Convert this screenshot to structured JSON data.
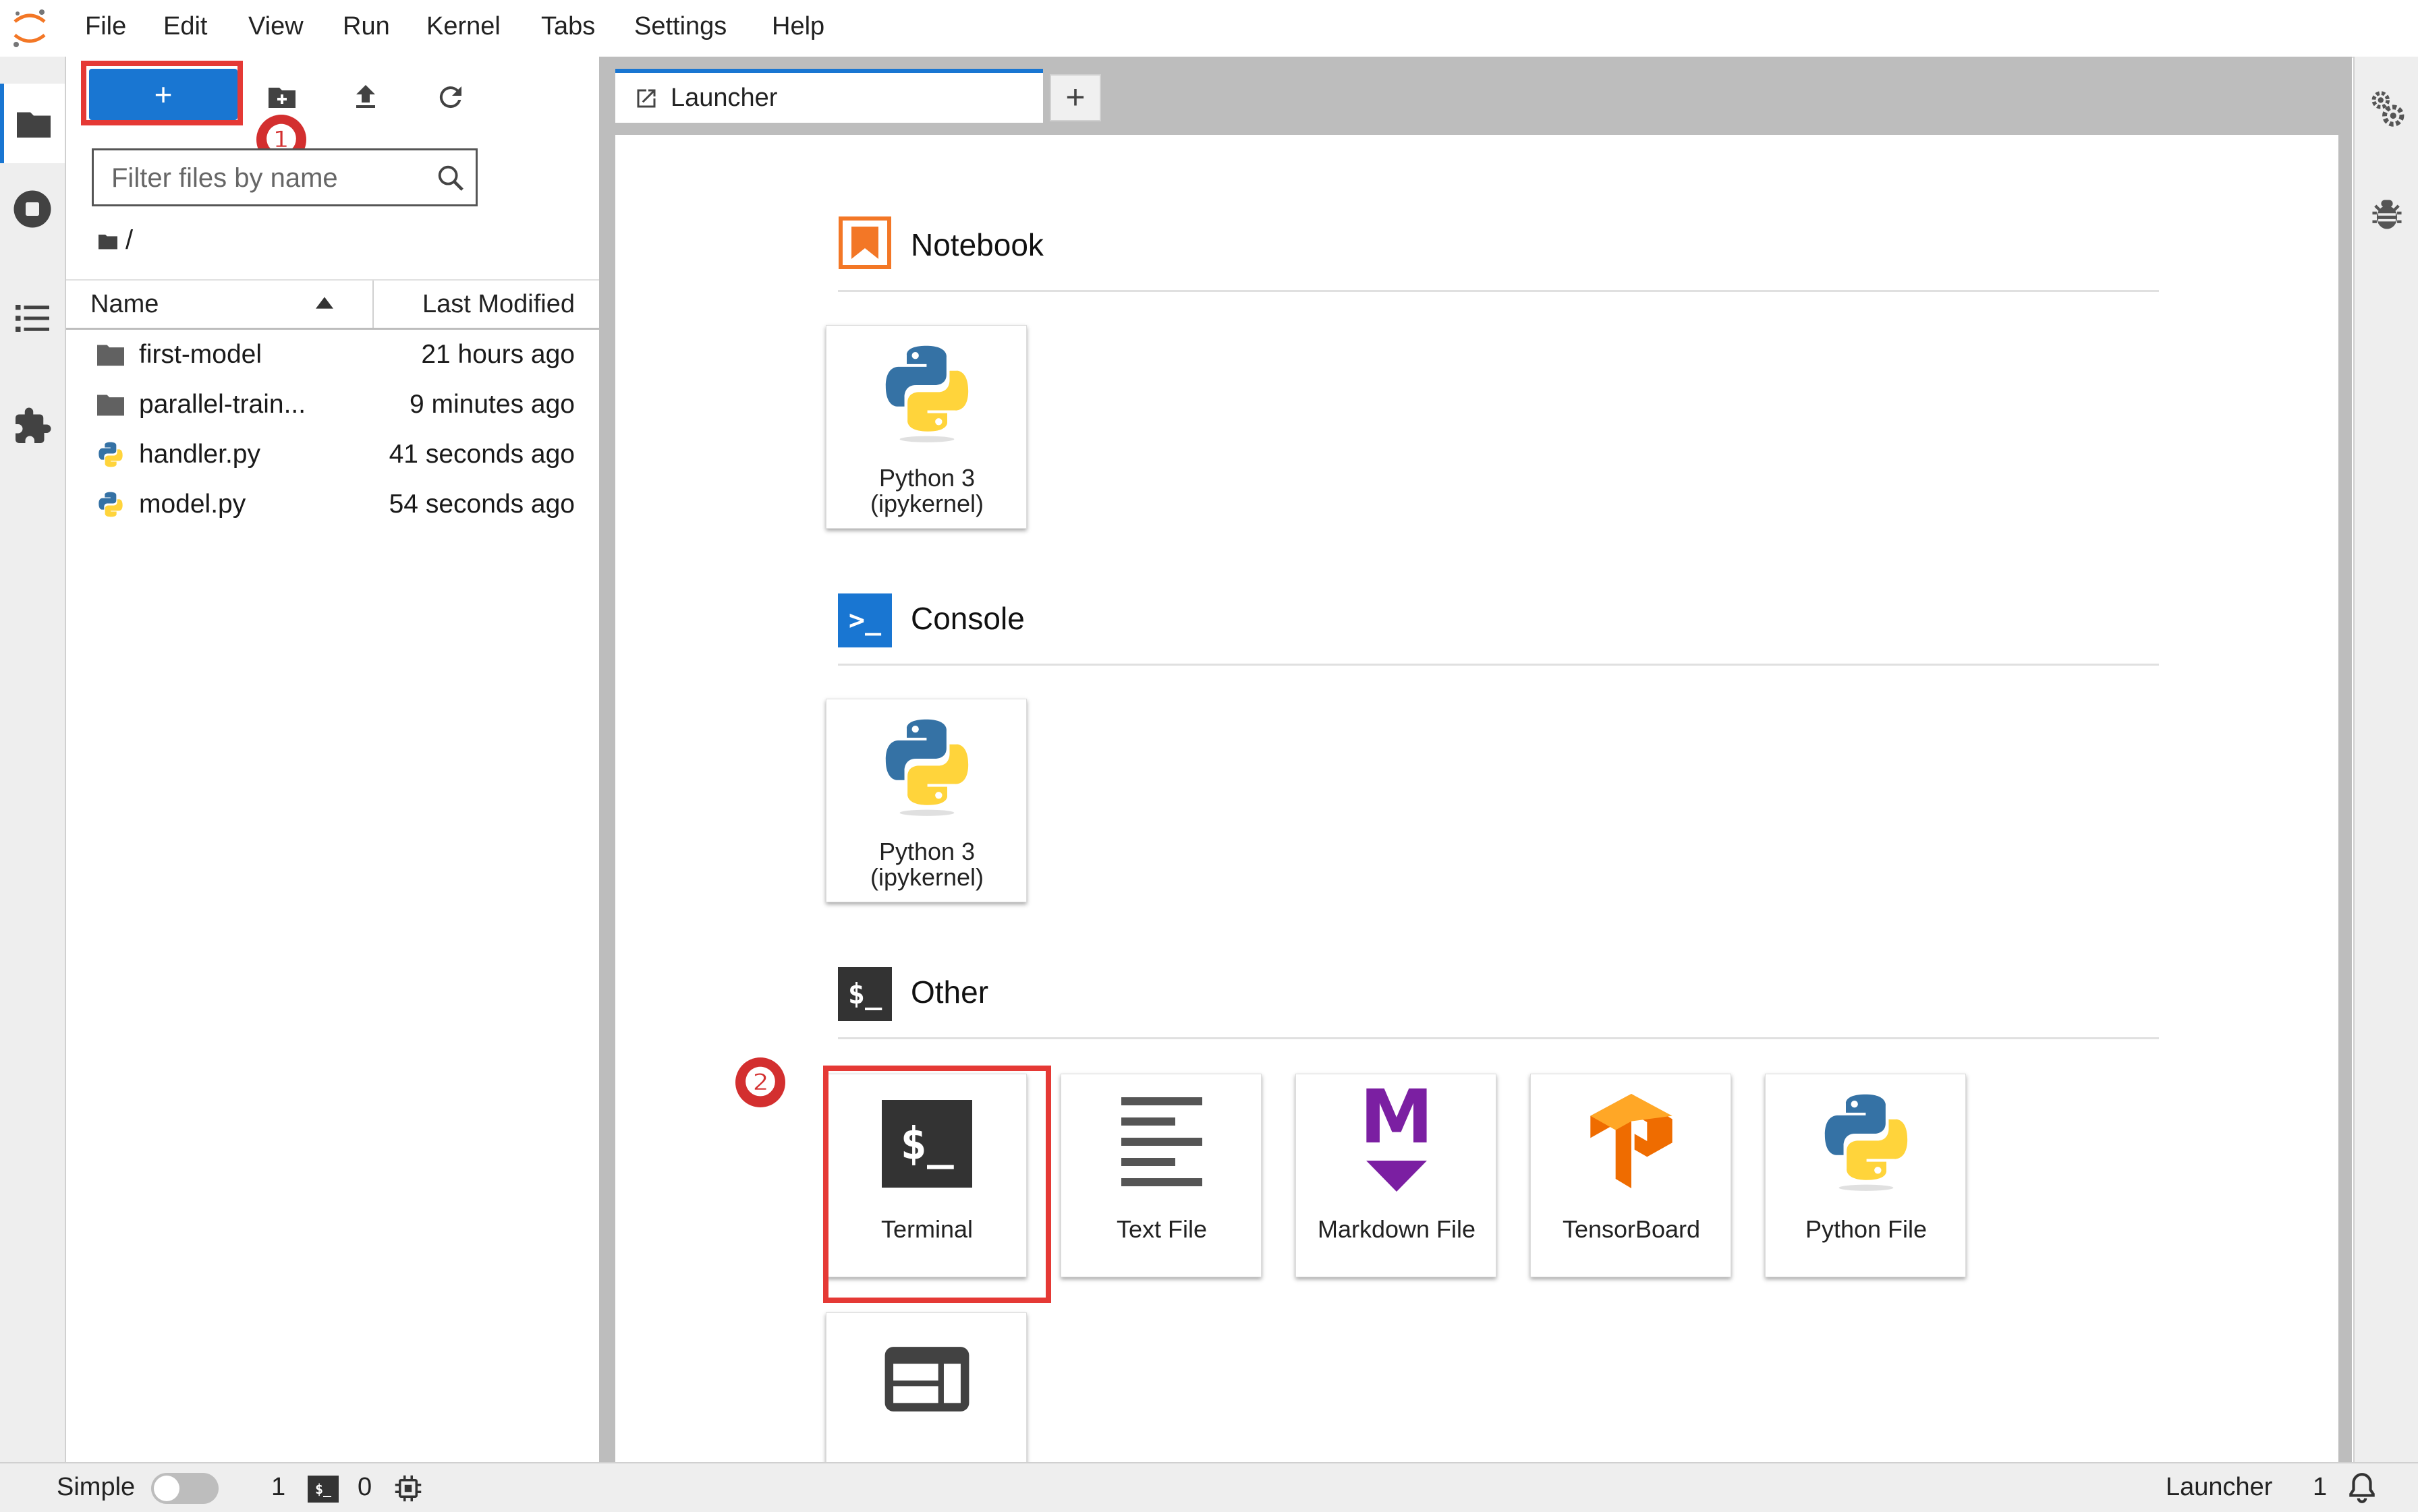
{
  "menu": {
    "items": [
      "File",
      "Edit",
      "View",
      "Run",
      "Kernel",
      "Tabs",
      "Settings",
      "Help"
    ]
  },
  "filebrowser": {
    "new_label": "+",
    "filter_placeholder": "Filter files by name",
    "breadcrumb": "/",
    "col_name": "Name",
    "col_modified": "Last Modified",
    "files": [
      {
        "name": "first-model",
        "modified": "21 hours ago",
        "type": "folder"
      },
      {
        "name": "parallel-train...",
        "modified": "9 minutes ago",
        "type": "folder"
      },
      {
        "name": "handler.py",
        "modified": "41 seconds ago",
        "type": "python"
      },
      {
        "name": "model.py",
        "modified": "54 seconds ago",
        "type": "python"
      }
    ]
  },
  "annotations": {
    "badge1": "❶",
    "badge2": "❷"
  },
  "tabs": {
    "launcher_label": "Launcher",
    "add_label": "+"
  },
  "launcher": {
    "notebook_title": "Notebook",
    "console_title": "Console",
    "other_title": "Other",
    "notebook_cards": [
      {
        "line1": "Python 3",
        "line2": "(ipykernel)"
      }
    ],
    "console_cards": [
      {
        "line1": "Python 3",
        "line2": "(ipykernel)"
      }
    ],
    "other_cards": [
      "Terminal",
      "Text File",
      "Markdown File",
      "TensorBoard",
      "Python File"
    ],
    "console_icon_text": ">_",
    "other_icon_text": "$_",
    "terminal_art_text": "$_",
    "markdown_art_text": "M"
  },
  "statusbar": {
    "mode_label": "Simple",
    "kernels_count": "1",
    "terminal_icon_text": "$_",
    "terminals_count": "0",
    "right_label": "Launcher",
    "right_count": "1"
  },
  "colors": {
    "accent": "#1976d2",
    "highlight": "#e53935",
    "notebook_orange": "#f37726",
    "markdown_purple": "#7b1fa2",
    "tensorboard_orange": "#ef6c00"
  }
}
